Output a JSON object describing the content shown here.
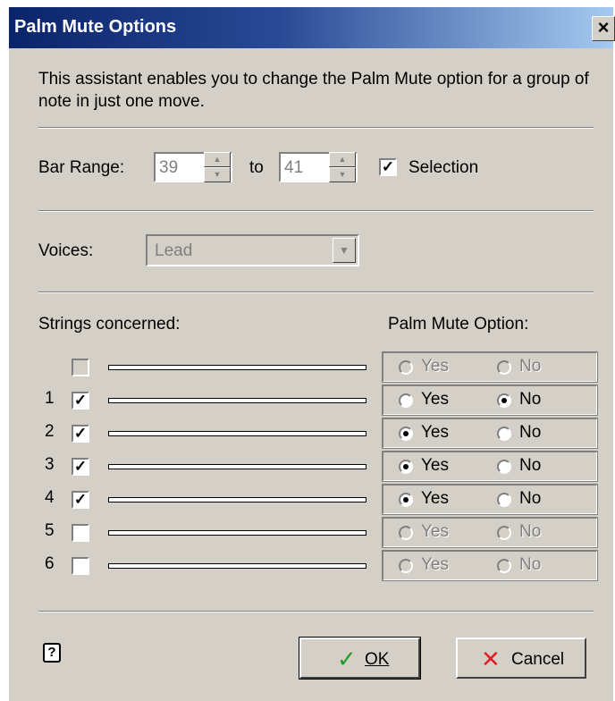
{
  "window": {
    "title": "Palm Mute Options",
    "close_glyph": "×"
  },
  "description": "This assistant enables you to change the Palm Mute option for a group of note in just one move.",
  "bar_range": {
    "label": "Bar Range:",
    "from": "39",
    "to_label": "to",
    "to": "41",
    "selection_label": "Selection",
    "selection_checked": true
  },
  "voices": {
    "label": "Voices:",
    "value": "Lead"
  },
  "strings": {
    "header": "Strings concerned:",
    "option_header": "Palm Mute Option:",
    "yes_label": "Yes",
    "no_label": "No",
    "rows": [
      {
        "number": "",
        "checked": false,
        "option": "none",
        "enabled": false
      },
      {
        "number": "1",
        "checked": true,
        "option": "no",
        "enabled": true
      },
      {
        "number": "2",
        "checked": true,
        "option": "yes",
        "enabled": true
      },
      {
        "number": "3",
        "checked": true,
        "option": "yes",
        "enabled": true
      },
      {
        "number": "4",
        "checked": true,
        "option": "yes",
        "enabled": true
      },
      {
        "number": "5",
        "checked": false,
        "option": "none",
        "enabled": false
      },
      {
        "number": "6",
        "checked": false,
        "option": "none",
        "enabled": false
      }
    ]
  },
  "buttons": {
    "ok": "OK",
    "cancel": "Cancel"
  },
  "icons": {
    "help": "help-icon",
    "ok": "checkmark-icon",
    "cancel": "x-icon",
    "close": "close-icon"
  },
  "colors": {
    "title_start": "#0a246a",
    "title_end": "#a6caf0",
    "face": "#d4d0c8",
    "ok_check": "#20a020",
    "cancel_x": "#e02020"
  }
}
